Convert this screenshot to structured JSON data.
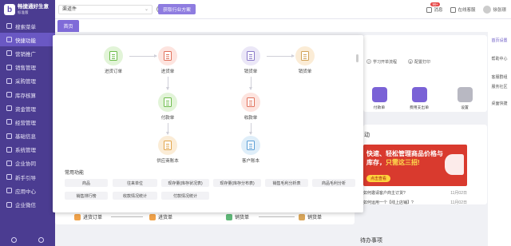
{
  "app": {
    "name": "畅捷通好生意",
    "version": "标准版"
  },
  "sidebar": {
    "items": [
      {
        "label": "搜索菜单",
        "active": false
      },
      {
        "label": "快捷功能",
        "active": true
      },
      {
        "label": "营销推广",
        "active": false
      },
      {
        "label": "销售管理",
        "active": false
      },
      {
        "label": "采购管理",
        "active": false
      },
      {
        "label": "库存核算",
        "active": false
      },
      {
        "label": "资金管理",
        "active": false
      },
      {
        "label": "经营管理",
        "active": false
      },
      {
        "label": "基础信息",
        "active": false
      },
      {
        "label": "系统管理",
        "active": false
      },
      {
        "label": "企业协同",
        "active": false
      },
      {
        "label": "新手引导",
        "active": false
      },
      {
        "label": "应用中心",
        "active": false
      },
      {
        "label": "企业微信",
        "active": false
      }
    ]
  },
  "topbar": {
    "store_value": "渠道件",
    "solution_label": "获取行业方案",
    "messages_label": "消息",
    "messages_badge": "99+",
    "service_label": "在线客服",
    "user_label": "徐张璟"
  },
  "tabs": [
    {
      "label": "首页"
    }
  ],
  "popup": {
    "flow": {
      "purchase_order": "进货订单",
      "purchase_in": "进货单",
      "payment": "付款单",
      "supplier_ledger": "供应商账本",
      "sales_order": "销货单",
      "sales_out": "销货单",
      "receipt": "收款单",
      "customer_ledger": "客户账本"
    },
    "common_title": "常用功能",
    "common_functions": [
      "商品",
      "往来单位",
      "现存量(库存状况表)",
      "现存量(库存分布表)",
      "销售毛利分析表",
      "商品毛利分析",
      "销售排行榜",
      "收款情况统计",
      "付款情况统计"
    ]
  },
  "background": {
    "steps": [
      {
        "num": "7",
        "label": "学习开单流程"
      },
      {
        "num": "8",
        "label": "配置打印"
      }
    ],
    "quick": [
      {
        "label": "付款单",
        "color": "#7a62d6"
      },
      {
        "label": "费用支出单",
        "color": "#7a62d6"
      },
      {
        "label": "设置",
        "color": "#9a9aa6"
      }
    ],
    "activity_title": "动",
    "banner": {
      "line1": "快速、轻松管理商品价格与",
      "line2_a": "库存，",
      "line2_b": "只需这三招!",
      "cta": "点击查看"
    },
    "news": [
      {
        "text": "如何邀请客户商主订货?",
        "date": "11月02日"
      },
      {
        "text": "如何运用一个【线上店铺】?",
        "date": "11月02日"
      }
    ],
    "todo_title": "待办事项"
  },
  "rightbar": {
    "items": [
      {
        "label": "首页设置",
        "active": true
      },
      {
        "label": "帮助中心",
        "active": false
      },
      {
        "label": "客服群组",
        "active": false
      },
      {
        "label": "服务社区",
        "active": false
      },
      {
        "label": "桌面快捷",
        "active": false
      }
    ]
  },
  "bottombar": {
    "nodes": [
      {
        "label": "进货订单",
        "color": "#f0a24a"
      },
      {
        "label": "进货单",
        "color": "#f0a24a"
      },
      {
        "label": "销货单",
        "color": "#5fb878"
      },
      {
        "label": "销货单",
        "color": "#d9a65a"
      }
    ]
  }
}
